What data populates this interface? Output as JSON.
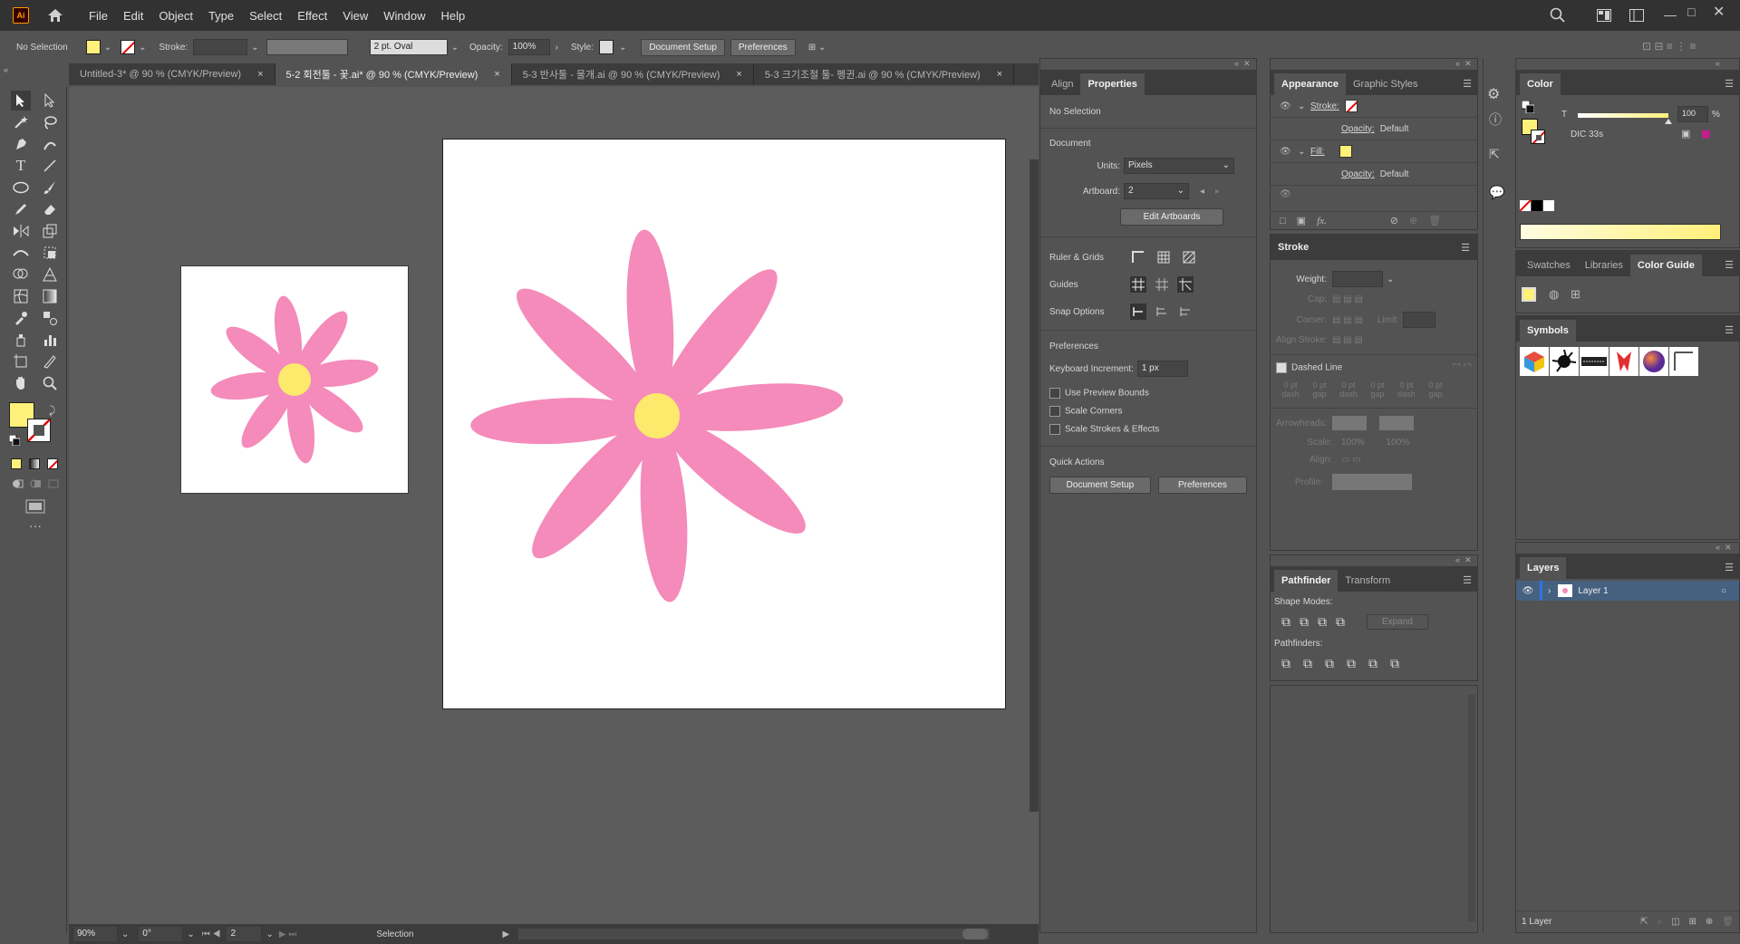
{
  "app": {
    "logo": "Ai",
    "menus": [
      "File",
      "Edit",
      "Object",
      "Type",
      "Select",
      "Effect",
      "View",
      "Window",
      "Help"
    ]
  },
  "control": {
    "selection": "No Selection",
    "stroke_label": "Stroke:",
    "brush": "2 pt. Oval",
    "opacity_label": "Opacity:",
    "opacity": "100%",
    "style_label": "Style:",
    "doc_setup": "Document Setup",
    "preferences": "Preferences"
  },
  "tabs": [
    {
      "label": "Untitled-3* @ 90 % (CMYK/Preview)"
    },
    {
      "label": "5-2 회전툴 - 꽃.ai* @ 90 % (CMYK/Preview)"
    },
    {
      "label": "5-3 반사툴 - 물개.ai @ 90 % (CMYK/Preview)"
    },
    {
      "label": "5-3 크기조절 툴- 펭귄.ai @ 90 % (CMYK/Preview)"
    }
  ],
  "tab_close": "×",
  "colors": {
    "fill": "#fff07a",
    "petal": "#f48bba",
    "center": "#fde96b",
    "accent": "#2d75e6"
  },
  "status": {
    "zoom": "90%",
    "angle": "0°",
    "artboard": "2",
    "tool": "Selection"
  },
  "properties": {
    "tabs": [
      "Align",
      "Properties"
    ],
    "selection": "No Selection",
    "document": "Document",
    "units_label": "Units:",
    "units": "Pixels",
    "artboard_label": "Artboard:",
    "artboard": "2",
    "edit_artboards": "Edit Artboards",
    "ruler_grids": "Ruler & Grids",
    "guides": "Guides",
    "snap_options": "Snap Options",
    "preferences": "Preferences",
    "kb_inc_label": "Keyboard Increment:",
    "kb_inc": "1 px",
    "use_preview": "Use Preview Bounds",
    "scale_corners": "Scale Corners",
    "scale_strokes": "Scale Strokes & Effects",
    "quick_actions": "Quick Actions",
    "doc_setup": "Document Setup",
    "prefs_btn": "Preferences"
  },
  "appearance": {
    "tabs": [
      "Appearance",
      "Graphic Styles"
    ],
    "stroke": "Stroke:",
    "opacity": "Opacity:",
    "default": "Default",
    "fill": "Fill:",
    "opacity2": "Opacity:",
    "default2": "Default",
    "fx": "fx."
  },
  "stroke_panel": {
    "title": "Stroke",
    "weight": "Weight:",
    "cap": "Cap:",
    "corner": "Corner:",
    "limit": "Limit:",
    "align": "Align Stroke:",
    "dashed": "Dashed Line",
    "dash_vals": [
      "0 pt",
      "0 pt",
      "0 pt",
      "0 pt",
      "0 pt",
      "0 pt"
    ],
    "dash_lbls": [
      "dash",
      "gap",
      "dash",
      "gap",
      "dash",
      "gap"
    ],
    "arrowheads": "Arrowheads:",
    "scale": "Scale:",
    "scale_v1": "100%",
    "scale_v2": "100%",
    "align2": "Align:",
    "profile": "Profile:"
  },
  "pathfinder": {
    "tabs": [
      "Pathfinder",
      "Transform"
    ],
    "shape_modes": "Shape Modes:",
    "expand": "Expand",
    "pathfinders": "Pathfinders:"
  },
  "color": {
    "title": "Color",
    "t": "T",
    "value": "100",
    "pct": "%",
    "name": "DIC 33s"
  },
  "swatches": {
    "tabs": [
      "Swatches",
      "Libraries",
      "Color Guide"
    ]
  },
  "symbols": {
    "title": "Symbols"
  },
  "layers": {
    "title": "Layers",
    "layer": "Layer 1",
    "count": "1 Layer"
  }
}
